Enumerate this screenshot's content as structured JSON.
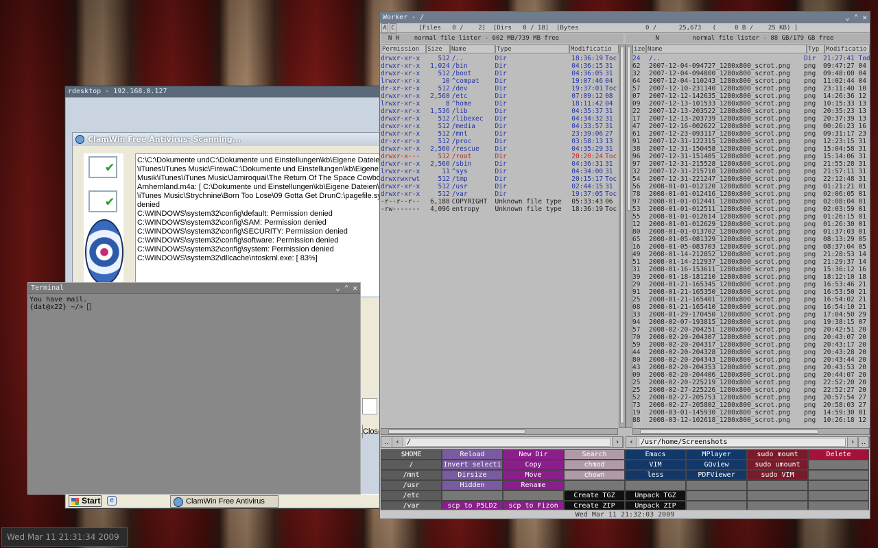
{
  "desktop": {
    "clock": "Wed Mar 11 21:31:34 2009"
  },
  "rdesktop": {
    "title": "rdesktop - 192.168.0.127",
    "clamwin_title": "ClamWin Free Antivirus: Scanning...",
    "log_lines": [
      "C:\\C:\\Dokumente undC:\\Dokumente und Einstellungen\\kb\\Eigene Dateien\\",
      "\\iTunes\\iTunes Music\\FirewaC:\\Dokumente und Einstellungen\\kb\\Eigene",
      "Musik\\iTunes\\iTunes Music\\Jamiroquai\\The Return Of The Space Cowboy",
      "Arnhemland.m4a: [ C:\\Dokumente und Einstellungen\\kb\\Eigene Dateien\\E",
      "\\iTunes Music\\Strychnine\\Born Too Lose\\09 Gotta Get DrunC:\\pagefile.sy",
      "denied",
      "C:\\WINDOWS\\system32\\config\\default: Permission denied",
      "C:\\WINDOWS\\system32\\config\\SAM: Permission denied",
      "C:\\WINDOWS\\system32\\config\\SECURITY: Permission denied",
      "C:\\WINDOWS\\system32\\config\\software: Permission denied",
      "C:\\WINDOWS\\system32\\config\\system: Permission denied",
      "C:\\WINDOWS\\system32\\dllcache\\ntoskrnl.exe: [ 83%]"
    ],
    "close_label": "Close",
    "start_label": "Start",
    "quicklaunch_icon": "e",
    "task_label": "ClamWin Free Antivirus"
  },
  "terminal": {
    "title": "Terminal",
    "line1": "You have mail.",
    "prompt": "{dat@x22} ~/> "
  },
  "worker": {
    "title": "Worker - /",
    "status_a": "A",
    "status_c": "C",
    "status_text": "      [Files   0 /    2]  [Dirs   0 / 18]  [Bytes                  0 /      25,673   (     0 B /    25 KB) ]",
    "left_head": "  N H    normal file lister - 602 MB/739 MB free",
    "right_head": "        N         normal file lister - 88 GB/179 GB free",
    "left_cols": [
      "Permission",
      "Size",
      "Name",
      "Type",
      "Modificatio"
    ],
    "right_cols": [
      "ize",
      "Name",
      "Typ",
      "Modificatio"
    ],
    "left_rows": [
      [
        "drwxr-xr-x",
        "512",
        "/..",
        "Dir",
        "18:36:19",
        "Toc",
        "b"
      ],
      [
        "drwxr-xr-x",
        "1,024",
        "/bin",
        "Dir",
        "04:36:15",
        "31",
        "b"
      ],
      [
        "drwxr-xr-x",
        "512",
        "/boot",
        "Dir",
        "04:36:05",
        "31",
        "b"
      ],
      [
        "lrwxr-xr-x",
        "10",
        "^compat",
        "Dir",
        "19:07:46",
        "04",
        "b"
      ],
      [
        "dr-xr-xr-x",
        "512",
        "/dev",
        "Dir",
        "19:37:01",
        "Toc",
        "b"
      ],
      [
        "drwxr-xr-x",
        "2,560",
        "/etc",
        "Dir",
        "07:09:12",
        "08",
        "b"
      ],
      [
        "lrwxr-xr-x",
        "8",
        "^home",
        "Dir",
        "18:11:42",
        "04",
        "b"
      ],
      [
        "drwxr-xr-x",
        "1,536",
        "/lib",
        "Dir",
        "04:35:37",
        "31",
        "b"
      ],
      [
        "drwxr-xr-x",
        "512",
        "/libexec",
        "Dir",
        "04:34:32",
        "31",
        "b"
      ],
      [
        "drwxr-xr-x",
        "512",
        "/media",
        "Dir",
        "04:33:57",
        "31",
        "b"
      ],
      [
        "drwxr-xr-x",
        "512",
        "/mnt",
        "Dir",
        "23:39:06",
        "27",
        "b"
      ],
      [
        "dr-xr-xr-x",
        "512",
        "/proc",
        "Dir",
        "03:58:13",
        "13",
        "b"
      ],
      [
        "drwxr-xr-x",
        "2,560",
        "/rescue",
        "Dir",
        "04:35:29",
        "31",
        "b"
      ],
      [
        "drwxr-x---",
        "512",
        "/root",
        "Dir",
        "20:20:24",
        "Toc",
        "r"
      ],
      [
        "drwxr-xr-x",
        "2,560",
        "/sbin",
        "Dir",
        "04:36:31",
        "31",
        "b"
      ],
      [
        "lrwxr-xr-x",
        "11",
        "^sys",
        "Dir",
        "04:34:00",
        "31",
        "b"
      ],
      [
        "drwxrwxrwt",
        "512",
        "/tmp",
        "Dir",
        "20:15:17",
        "Toc",
        "b"
      ],
      [
        "drwxr-xr-x",
        "512",
        "/usr",
        "Dir",
        "02:44:15",
        "31",
        "b"
      ],
      [
        "drwxr-xr-x",
        "512",
        "/var",
        "Dir",
        "19:37:05",
        "Toc",
        "b"
      ],
      [
        "-r--r--r--",
        "6,188",
        "COPYRIGHT",
        "Unknown file type",
        "05:33:43",
        "06",
        "d"
      ],
      [
        "-rw-------",
        "4,096",
        "entropy",
        "Unknown file type",
        "18:36:19",
        "Toc",
        "d"
      ]
    ],
    "right_rows": [
      [
        "24",
        "/..",
        "Dir",
        "21:27:41 Tod"
      ],
      [
        "62",
        "2007-12-04-094727_1280x800_scrot.png",
        "png",
        "09:47:27 04"
      ],
      [
        "32",
        "2007-12-04-094800_1280x800_scrot.png",
        "png",
        "09:48:00 04"
      ],
      [
        "64",
        "2007-12-04-110243_1280x800_scrot.png",
        "png",
        "11:02:44 04"
      ],
      [
        "57",
        "2007-12-10-231140_1280x800_scrot.png",
        "png",
        "23:11:40 10"
      ],
      [
        "07",
        "2007-12-12-142635_1280x800_scrot.png",
        "png",
        "14:26:36 12"
      ],
      [
        "09",
        "2007-12-13-101533_1280x800_scrot.png",
        "png",
        "10:15:33 13"
      ],
      [
        "22",
        "2007-12-13-203522_1280x800_scrot.png",
        "png",
        "20:35:23 13"
      ],
      [
        "17",
        "2007-12-13-203739_1280x800_scrot.png",
        "png",
        "20:37:39 13"
      ],
      [
        "47",
        "2007-12-16-002622_1280x800_scrot.png",
        "png",
        "00:26:23 16"
      ],
      [
        "61",
        "2007-12-23-093117_1280x800_scrot.png",
        "png",
        "09:31:17 23"
      ],
      [
        "91",
        "2007-12-31-122315_1280x800_scrot.png",
        "png",
        "12:23:15 31"
      ],
      [
        "38",
        "2007-12-31-150458_1280x800_scrot.png",
        "png",
        "15:04:58 31"
      ],
      [
        "96",
        "2007-12-31-151405_1280x800_scrot.png",
        "png",
        "15:14:06 31"
      ],
      [
        "97",
        "2007-12-31-215528_1280x800_scrot.png",
        "png",
        "21:55:28 31"
      ],
      [
        "32",
        "2007-12-31-215710_1280x800_scrot.png",
        "png",
        "21:57:11 31"
      ],
      [
        "54",
        "2007-12-31-221247_1280x800_scrot.png",
        "png",
        "22:12:48 31"
      ],
      [
        "56",
        "2008-01-01-012120_1280x800_scrot.png",
        "png",
        "01:21:21 01"
      ],
      [
        "78",
        "2008-01-01-012416_1280x800_scrot.png",
        "png",
        "02:06:05 01"
      ],
      [
        "97",
        "2008-01-01-012441_1280x800_scrot.png",
        "png",
        "02:08:04 01"
      ],
      [
        "53",
        "2008-01-01-012511_1280x800_scrot.png",
        "png",
        "02:03:59 01"
      ],
      [
        "55",
        "2008-01-01-012614_1280x800_scrot.png",
        "png",
        "01:26:15 01"
      ],
      [
        "12",
        "2008-01-01-012629_1280x800_scrot.png",
        "png",
        "01:26:30 01"
      ],
      [
        "80",
        "2008-01-01-013702_1280x800_scrot.png",
        "png",
        "01:37:03 01"
      ],
      [
        "65",
        "2008-01-05-081329_1280x800_scrot.png",
        "png",
        "08:13:29 05"
      ],
      [
        "16",
        "2008-01-05-083703_1280x800_scrot.png",
        "png",
        "08:37:04 05"
      ],
      [
        "49",
        "2008-01-14-212852_1280x800_scrot.png",
        "png",
        "21:28:53 14"
      ],
      [
        "51",
        "2008-01-14-212937_1280x800_scrot.png",
        "png",
        "21:29:37 14"
      ],
      [
        "31",
        "2008-01-16-153611_1280x800_scrot.png",
        "png",
        "15:36:12 16"
      ],
      [
        "39",
        "2008-01-18-181210_1280x800_scrot.png",
        "png",
        "18:12:10 18"
      ],
      [
        "29",
        "2008-01-21-165345_1280x800_scrot.png",
        "png",
        "16:53:46 21"
      ],
      [
        "91",
        "2008-01-21-165350_1280x800_scrot.png",
        "png",
        "16:53:50 21"
      ],
      [
        "25",
        "2008-01-21-165401_1280x800_scrot.png",
        "png",
        "16:54:02 21"
      ],
      [
        "08",
        "2008-01-21-165410_1280x800_scrot.png",
        "png",
        "16:54:10 21"
      ],
      [
        "33",
        "2008-01-29-170450_1280x800_scrot.png",
        "png",
        "17:04:50 29"
      ],
      [
        "94",
        "2008-02-07-193815_1280x800_scrot.png",
        "png",
        "19:38:15 07"
      ],
      [
        "57",
        "2008-02-20-204251_1280x800_scrot.png",
        "png",
        "20:42:51 20"
      ],
      [
        "70",
        "2008-02-20-204307_1280x800_scrot.png",
        "png",
        "20:43:07 20"
      ],
      [
        "59",
        "2008-02-20-204317_1280x800_scrot.png",
        "png",
        "20:43:17 20"
      ],
      [
        "44",
        "2008-02-20-204328_1280x800_scrot.png",
        "png",
        "20:43:28 20"
      ],
      [
        "80",
        "2008-02-20-204343_1280x800_scrot.png",
        "png",
        "20:43:44 20"
      ],
      [
        "43",
        "2008-02-20-204353_1280x800_scrot.png",
        "png",
        "20:43:53 20"
      ],
      [
        "09",
        "2008-02-20-204406_1280x800_scrot.png",
        "png",
        "20:44:07 20"
      ],
      [
        "25",
        "2008-02-20-225219_1280x800_scrot.png",
        "png",
        "22:52:20 20"
      ],
      [
        "25",
        "2008-02-27-225226_1280x800_scrot.png",
        "png",
        "22:52:27 20"
      ],
      [
        "52",
        "2008-02-27-205753_1280x800_scrot.png",
        "png",
        "20:57:54 27"
      ],
      [
        "73",
        "2008-02-27-205802_1280x800_scrot.png",
        "png",
        "20:58:03 27"
      ],
      [
        "19",
        "2008-03-01-145930_1280x800_scrot.png",
        "png",
        "14:59:30 01"
      ],
      [
        "88",
        "2008-03-12-102618_1280x800_scrot.png",
        "png",
        "10:26:18 12"
      ]
    ],
    "left_path": "/",
    "right_path": "/usr/home/Screenshots",
    "buttons": [
      [
        "$HOME",
        "gray"
      ],
      [
        "Reload",
        "purple"
      ],
      [
        "New Dir",
        "mag"
      ],
      [
        "Search",
        "pink"
      ],
      [
        "Emacs",
        "navy"
      ],
      [
        "MPlayer",
        "navy"
      ],
      [
        "sudo mount",
        "darkred"
      ],
      [
        "Delete",
        "crimson"
      ],
      [
        "/",
        "gray"
      ],
      [
        "Invert selecti",
        "purple"
      ],
      [
        "Copy",
        "mag"
      ],
      [
        "chmod",
        "pink"
      ],
      [
        "VIM",
        "navy"
      ],
      [
        "GQview",
        "navy"
      ],
      [
        "sudo umount",
        "darkred"
      ],
      [
        "",
        "empty"
      ],
      [
        "/mnt",
        "gray"
      ],
      [
        "Dirsize",
        "purple"
      ],
      [
        "Move",
        "mag"
      ],
      [
        "chown",
        "pink"
      ],
      [
        "less",
        "navy"
      ],
      [
        "PDFViewer",
        "navy"
      ],
      [
        "sudo VIM",
        "darkred"
      ],
      [
        "",
        "empty"
      ],
      [
        "/usr",
        "gray"
      ],
      [
        "Hidden",
        "purple"
      ],
      [
        "Rename",
        "mag"
      ],
      [
        "",
        "empty"
      ],
      [
        "",
        "empty"
      ],
      [
        "",
        "empty"
      ],
      [
        "",
        "empty"
      ],
      [
        "",
        "empty"
      ],
      [
        "/etc",
        "gray"
      ],
      [
        "",
        "empty"
      ],
      [
        "",
        "empty"
      ],
      [
        "Create TGZ",
        "black"
      ],
      [
        "Unpack TGZ",
        "black"
      ],
      [
        "",
        "empty"
      ],
      [
        "",
        "empty"
      ],
      [
        "",
        "empty"
      ],
      [
        "/var",
        "gray"
      ],
      [
        "scp to P5LD2",
        "mag"
      ],
      [
        "scp to Fizon",
        "mag"
      ],
      [
        "Create ZIP",
        "black"
      ],
      [
        "Unpack ZIP",
        "black"
      ],
      [
        "",
        "empty"
      ],
      [
        "",
        "empty"
      ],
      [
        "",
        "empty"
      ]
    ],
    "clock": "Wed Mar 11 21:32:03 2009"
  }
}
